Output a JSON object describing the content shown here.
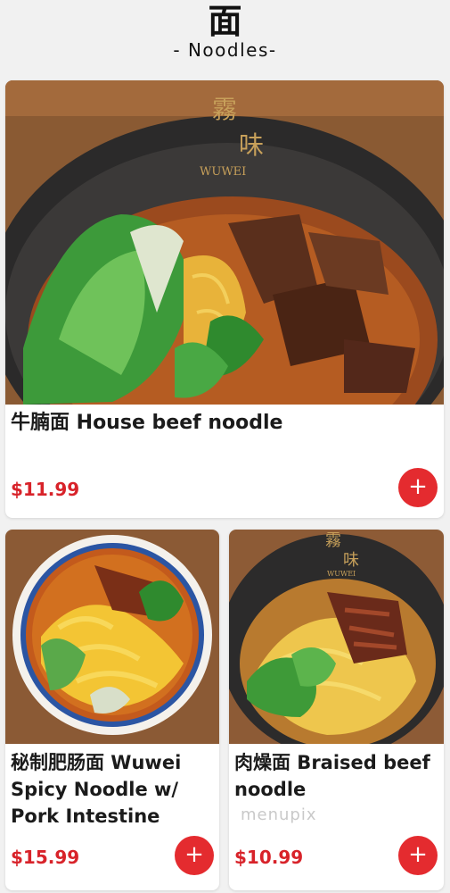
{
  "header": {
    "title_cn": "面",
    "title_en": "- Noodles-"
  },
  "items": [
    {
      "title": "牛腩面 House beef noodle",
      "price": "$11.99",
      "add_icon": "plus-icon"
    },
    {
      "title": "秘制肥肠面 Wuwei Spicy Noodle w/ Pork Intestine",
      "price": "$15.99",
      "add_icon": "plus-icon"
    },
    {
      "title": "肉燥面 Braised beef noodle",
      "price": "$10.99",
      "add_icon": "plus-icon"
    }
  ],
  "bowl_brand": {
    "cn1": "霧",
    "cn2": "味",
    "en": "WUWEI"
  },
  "watermark": "menupix",
  "colors": {
    "accent": "#e42b2f",
    "price": "#d8232a",
    "background": "#f1f1f1"
  }
}
